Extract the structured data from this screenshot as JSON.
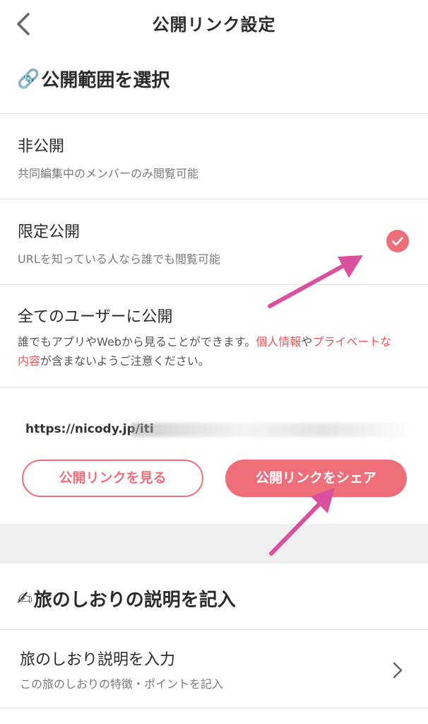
{
  "header": {
    "title": "公開リンク設定",
    "back_icon": "chevron-left-icon"
  },
  "visibility_section": {
    "icon": "link-icon",
    "icon_glyph": "🔗",
    "title": "公開範囲を選択",
    "options": [
      {
        "title": "非公開",
        "description": "共同編集中のメンバーのみ閲覧可能",
        "selected": false
      },
      {
        "title": "限定公開",
        "description": "URLを知っている人なら誰でも閲覧可能",
        "selected": true
      },
      {
        "title": "全てのユーザーに公開",
        "description_parts": [
          {
            "text": "誰でもアプリやWebから見ることができます。",
            "emphasis": false
          },
          {
            "text": "個人情報",
            "emphasis": true
          },
          {
            "text": "や",
            "emphasis": false
          },
          {
            "text": "プライベートな内容",
            "emphasis": true
          },
          {
            "text": "が含まないようご注意ください。",
            "emphasis": false
          }
        ],
        "selected": false
      }
    ]
  },
  "link": {
    "url": "https://nicody.jp/iti"
  },
  "buttons": {
    "view_label": "公開リンクを見る",
    "share_label": "公開リンクをシェア"
  },
  "description_section": {
    "icon": "writing-hand-icon",
    "icon_glyph": "✍",
    "title": "旅のしおりの説明を記入",
    "row_title": "旅のしおり説明を入力",
    "row_subtitle": "この旅のしおりの特徴・ポイントを記入"
  },
  "colors": {
    "accent": "#ee6e7a",
    "emphasis_red": "#e4575a",
    "arrow_magenta": "#d9509f",
    "divider": "#e2e2e2",
    "band_gray": "#efeff1"
  }
}
